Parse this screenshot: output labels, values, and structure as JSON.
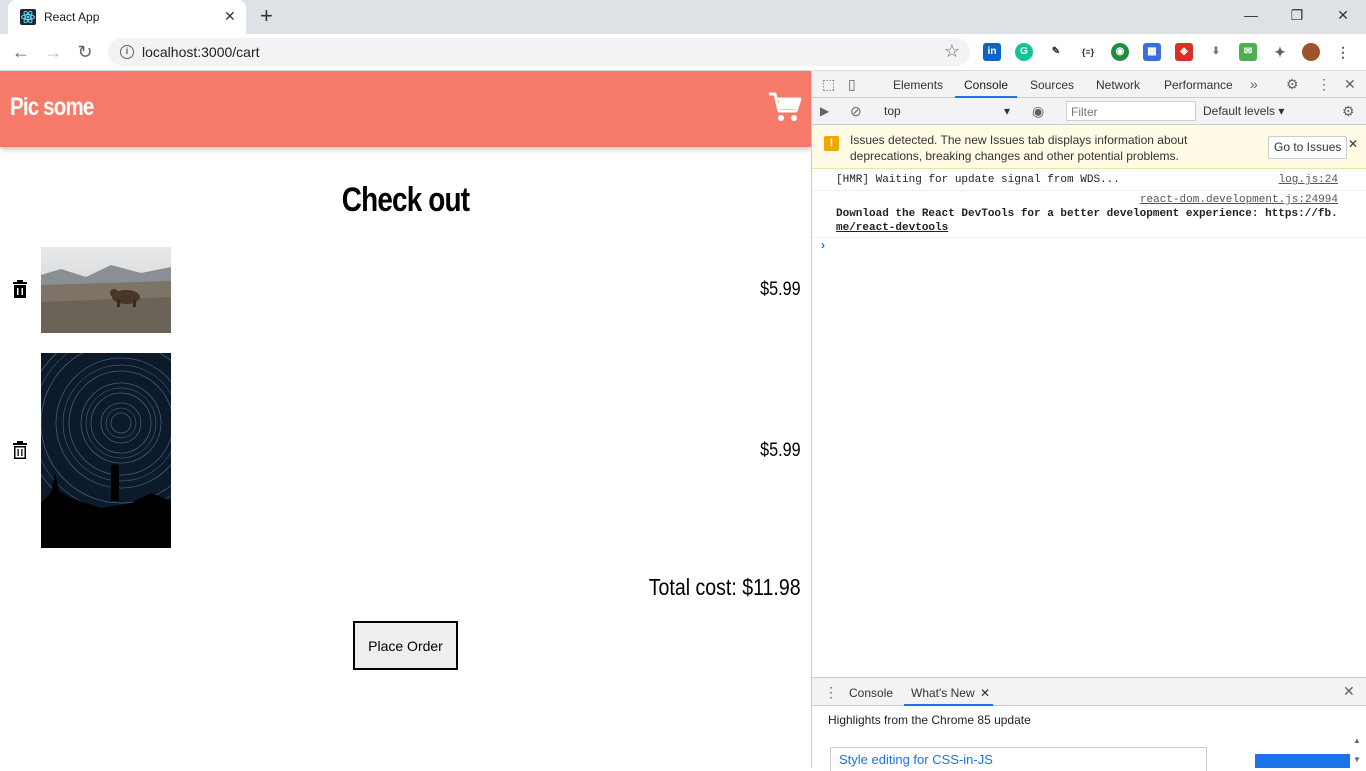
{
  "browser": {
    "tab_title": "React App",
    "url": "localhost:3000/cart"
  },
  "app": {
    "brand": "Pic some",
    "checkout_title": "Check out",
    "items": [
      {
        "price": "$5.99",
        "thumb": "bear-photo"
      },
      {
        "price": "$5.99",
        "thumb": "star-trails-photo"
      }
    ],
    "total": "Total cost: $11.98",
    "place_order": "Place Order",
    "colors": {
      "header": "#f67a6a"
    }
  },
  "devtools": {
    "tabs": [
      "Elements",
      "Console",
      "Sources",
      "Network",
      "Performance"
    ],
    "context": "top",
    "filter_placeholder": "Filter",
    "levels": "Default levels ▾",
    "issues_text": "Issues detected. The new Issues tab displays information about deprecations, breaking changes and other potential problems.",
    "go_issues": "Go to Issues",
    "log1": "[HMR] Waiting for update signal from WDS...",
    "log1_src": "log.js:24",
    "log2_src": "react-dom.development.js:24994",
    "log2_line1": "Download the React DevTools for a better development experience: https://fb.",
    "log2_line2": "me/react-devtools",
    "drawer_tabs": [
      "Console",
      "What's New"
    ],
    "highlights": "Highlights from the Chrome 85 update",
    "card_title": "Style editing for CSS-in-JS"
  }
}
